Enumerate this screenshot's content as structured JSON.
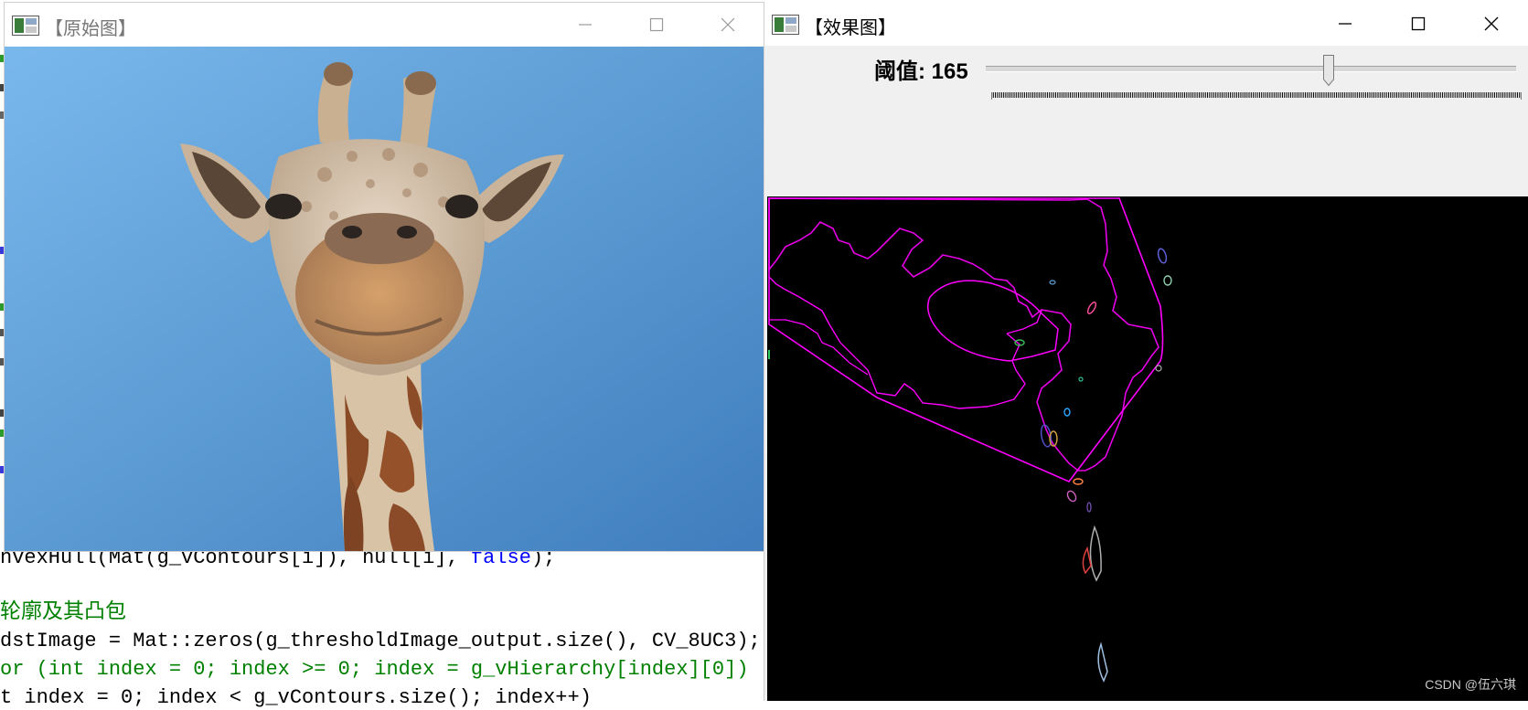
{
  "editor": {
    "lines": [
      {
        "segments": [
          {
            "t": "nvexHull(Mat(g_vContours[i]), hull[i], ",
            "c": ""
          },
          {
            "t": "false",
            "c": "kw"
          },
          {
            "t": ");",
            "c": ""
          }
        ]
      },
      {
        "segments": []
      },
      {
        "segments": [
          {
            "t": "轮廓及其凸包",
            "c": "cm"
          }
        ]
      },
      {
        "segments": [
          {
            "t": "dstImage = Mat::zeros(g_thresholdImage_output.size(), CV_8UC3);",
            "c": ""
          }
        ]
      },
      {
        "segments": [
          {
            "t": "or (int index = 0; index >= 0; index = g_vHierarchy[index][0])",
            "c": "cm"
          }
        ]
      },
      {
        "segments": [
          {
            "t": "t index = 0; index < g_vContours.size(); index++)",
            "c": ""
          }
        ]
      }
    ]
  },
  "window_original": {
    "title": "【原始图】",
    "controls": [
      "minimize-icon",
      "maximize-icon",
      "close-icon"
    ]
  },
  "window_result": {
    "title": "【效果图】",
    "trackbar": {
      "label": "阈值: 165",
      "value": 165,
      "max": 255
    },
    "watermark": "CSDN @伍六琪",
    "contour_color": "#ff00ff",
    "controls": [
      "minimize-icon",
      "maximize-icon",
      "close-icon"
    ]
  },
  "colors": {
    "sky": "#5b98d0",
    "contour_main": "#ff00ff",
    "canvas_bg": "#000000",
    "window_bg": "#f0f0f0"
  }
}
